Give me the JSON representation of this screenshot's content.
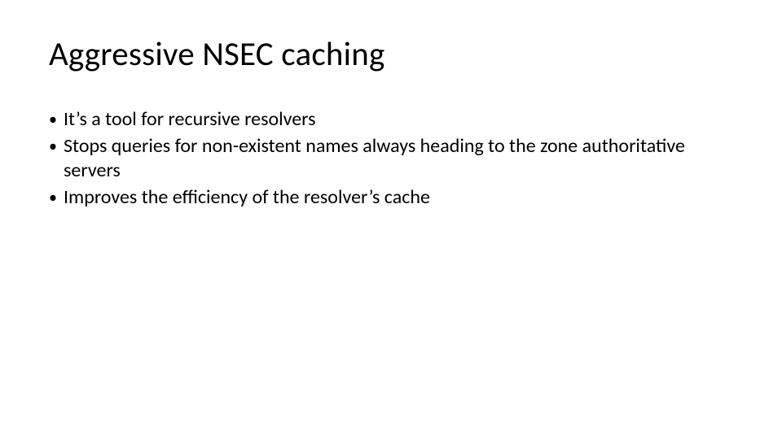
{
  "title": "Aggressive NSEC caching",
  "bullets": [
    "It’s a tool for recursive resolvers",
    "Stops queries for non-existent names always heading to the zone authoritative servers",
    "Improves the efficiency of the resolver’s cache"
  ]
}
